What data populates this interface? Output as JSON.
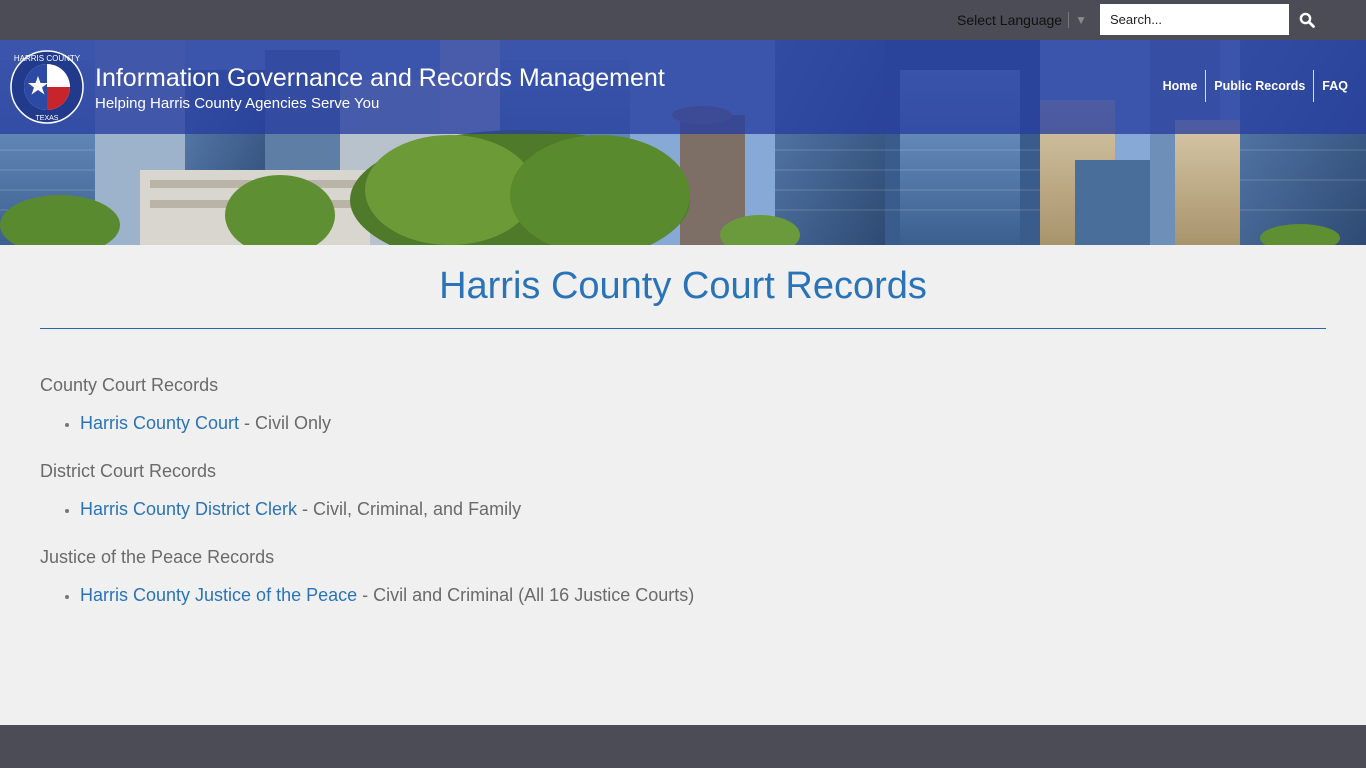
{
  "topbar": {
    "language_label": "Select Language",
    "language_caret": "▼",
    "search_placeholder": "Search..."
  },
  "header": {
    "logo_text_top": "HARRIS COUNTY",
    "logo_text_bottom": "TEXAS",
    "title": "Information Governance and Records Management",
    "tagline": "Helping Harris County Agencies Serve You",
    "nav": [
      {
        "label": "Home"
      },
      {
        "label": "Public Records"
      },
      {
        "label": "FAQ"
      }
    ]
  },
  "main": {
    "title": "Harris County Court Records",
    "sections": [
      {
        "heading": "County Court Records",
        "link": "Harris County Court",
        "desc": " - Civil Only"
      },
      {
        "heading": "District Court Records",
        "link": "Harris County District Clerk",
        "desc": " - Civil, Criminal, and Family"
      },
      {
        "heading": "Justice of the Peace Records",
        "link": "Harris County Justice of the Peace",
        "desc": " - Civil and Criminal (All 16 Justice Courts)"
      }
    ]
  },
  "colors": {
    "topbar_bg": "#4b4c55",
    "accent_blue": "#2a73b8",
    "band_blue": "#263ea0",
    "body_bg": "#f0f0f0",
    "text_gray": "#6a6a6a"
  }
}
